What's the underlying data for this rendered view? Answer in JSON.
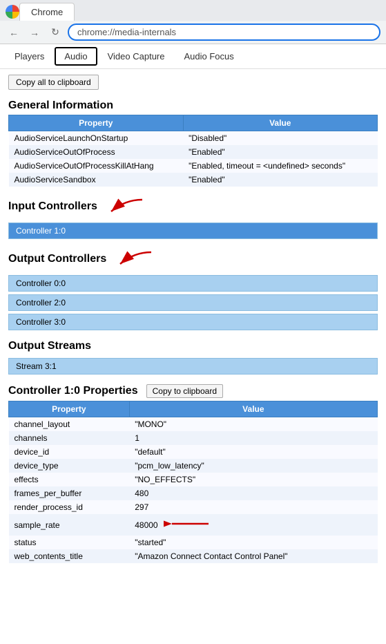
{
  "browser": {
    "tab_label": "Chrome",
    "address": "chrome://media-internals",
    "nav_back_icon": "←",
    "nav_forward_icon": "→",
    "nav_reload_icon": "↻"
  },
  "tabs": [
    {
      "id": "players",
      "label": "Players",
      "active": false
    },
    {
      "id": "audio",
      "label": "Audio",
      "active": true
    },
    {
      "id": "video_capture",
      "label": "Video Capture",
      "active": false
    },
    {
      "id": "audio_focus",
      "label": "Audio Focus",
      "active": false
    }
  ],
  "copy_all_button_label": "Copy all to clipboard",
  "general_information": {
    "heading": "General Information",
    "table_headers": [
      "Property",
      "Value"
    ],
    "rows": [
      {
        "property": "AudioServiceLaunchOnStartup",
        "value": "\"Disabled\""
      },
      {
        "property": "AudioServiceOutOfProcess",
        "value": "\"Enabled\""
      },
      {
        "property": "AudioServiceOutOfProcessKillAtHang",
        "value": "\"Enabled, timeout = <undefined> seconds\""
      },
      {
        "property": "AudioServiceSandbox",
        "value": "\"Enabled\""
      }
    ]
  },
  "input_controllers": {
    "heading": "Input Controllers",
    "items": [
      {
        "label": "Controller 1:0",
        "highlighted": true
      }
    ]
  },
  "output_controllers": {
    "heading": "Output Controllers",
    "items": [
      {
        "label": "Controller 0:0",
        "highlighted": false
      },
      {
        "label": "Controller 2:0",
        "highlighted": false
      },
      {
        "label": "Controller 3:0",
        "highlighted": false
      }
    ]
  },
  "output_streams": {
    "heading": "Output Streams",
    "items": [
      {
        "label": "Stream 3:1"
      }
    ]
  },
  "controller_properties": {
    "heading": "Controller 1:0 Properties",
    "copy_button_label": "Copy to clipboard",
    "table_headers": [
      "Property",
      "Value"
    ],
    "rows": [
      {
        "property": "channel_layout",
        "value": "\"MONO\""
      },
      {
        "property": "channels",
        "value": "1"
      },
      {
        "property": "device_id",
        "value": "\"default\""
      },
      {
        "property": "device_type",
        "value": "\"pcm_low_latency\""
      },
      {
        "property": "effects",
        "value": "\"NO_EFFECTS\""
      },
      {
        "property": "frames_per_buffer",
        "value": "480"
      },
      {
        "property": "render_process_id",
        "value": "297"
      },
      {
        "property": "sample_rate",
        "value": "48000",
        "has_arrow": true
      },
      {
        "property": "status",
        "value": "\"started\""
      },
      {
        "property": "web_contents_title",
        "value": "\"Amazon Connect Contact Control Panel\""
      }
    ]
  }
}
